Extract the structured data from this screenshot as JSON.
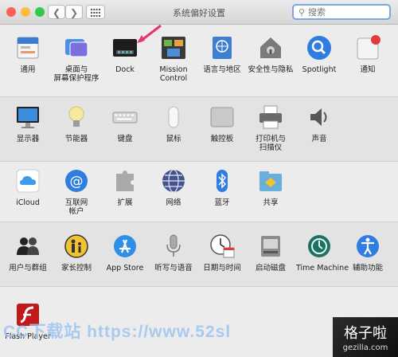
{
  "window": {
    "title": "系统偏好设置",
    "search": {
      "placeholder": "搜索",
      "value": ""
    },
    "traffic_lights": {
      "close": "#fc605b",
      "minimize": "#fdbc40",
      "zoom": "#34c84a"
    }
  },
  "sections": [
    {
      "name": "personal",
      "items": [
        {
          "id": "general",
          "label": "通用",
          "icon": "general-icon"
        },
        {
          "id": "desktop",
          "label": "桌面与\n屏幕保护程序",
          "icon": "desktop-screensaver-icon"
        },
        {
          "id": "dock",
          "label": "Dock",
          "icon": "dock-icon"
        },
        {
          "id": "mission",
          "label": "Mission\nControl",
          "icon": "mission-control-icon"
        },
        {
          "id": "language",
          "label": "语言与地区",
          "icon": "language-region-icon"
        },
        {
          "id": "security",
          "label": "安全性与隐私",
          "icon": "security-privacy-icon"
        },
        {
          "id": "spotlight",
          "label": "Spotlight",
          "icon": "spotlight-icon"
        },
        {
          "id": "notifications",
          "label": "通知",
          "icon": "notifications-icon"
        }
      ]
    },
    {
      "name": "hardware",
      "items": [
        {
          "id": "displays",
          "label": "显示器",
          "icon": "displays-icon"
        },
        {
          "id": "energy",
          "label": "节能器",
          "icon": "energy-saver-icon"
        },
        {
          "id": "keyboard",
          "label": "键盘",
          "icon": "keyboard-icon"
        },
        {
          "id": "mouse",
          "label": "鼠标",
          "icon": "mouse-icon"
        },
        {
          "id": "trackpad",
          "label": "触控板",
          "icon": "trackpad-icon"
        },
        {
          "id": "printers",
          "label": "打印机与\n扫描仪",
          "icon": "printer-icon"
        },
        {
          "id": "sound",
          "label": "声音",
          "icon": "sound-icon"
        }
      ]
    },
    {
      "name": "internet",
      "items": [
        {
          "id": "icloud",
          "label": "iCloud",
          "icon": "icloud-icon"
        },
        {
          "id": "internet-accounts",
          "label": "互联网\n帐户",
          "icon": "internet-accounts-icon"
        },
        {
          "id": "extensions",
          "label": "扩展",
          "icon": "extensions-icon"
        },
        {
          "id": "network",
          "label": "网络",
          "icon": "network-icon"
        },
        {
          "id": "bluetooth",
          "label": "蓝牙",
          "icon": "bluetooth-icon"
        },
        {
          "id": "sharing",
          "label": "共享",
          "icon": "sharing-icon"
        }
      ]
    },
    {
      "name": "system",
      "items": [
        {
          "id": "users",
          "label": "用户与群组",
          "icon": "users-groups-icon"
        },
        {
          "id": "parental",
          "label": "家长控制",
          "icon": "parental-controls-icon"
        },
        {
          "id": "appstore",
          "label": "App Store",
          "icon": "app-store-icon"
        },
        {
          "id": "dictation",
          "label": "听写与语音",
          "icon": "dictation-speech-icon"
        },
        {
          "id": "datetime",
          "label": "日期与时间",
          "icon": "date-time-icon"
        },
        {
          "id": "startup",
          "label": "启动磁盘",
          "icon": "startup-disk-icon"
        },
        {
          "id": "timemachine",
          "label": "Time Machine",
          "icon": "time-machine-icon"
        },
        {
          "id": "accessibility",
          "label": "辅助功能",
          "icon": "accessibility-icon"
        }
      ]
    },
    {
      "name": "other",
      "items": [
        {
          "id": "flash",
          "label": "Flash Player",
          "icon": "flash-player-icon"
        }
      ]
    }
  ],
  "watermark": {
    "left_text": "CC下载站 https://www.52sl",
    "badge_text": "格子啦",
    "badge_url": "gezilla.com"
  },
  "colors": {
    "window_bg": "#ececec",
    "alt_section_bg": "#e2e2e2",
    "arrow": "#e8336b"
  }
}
